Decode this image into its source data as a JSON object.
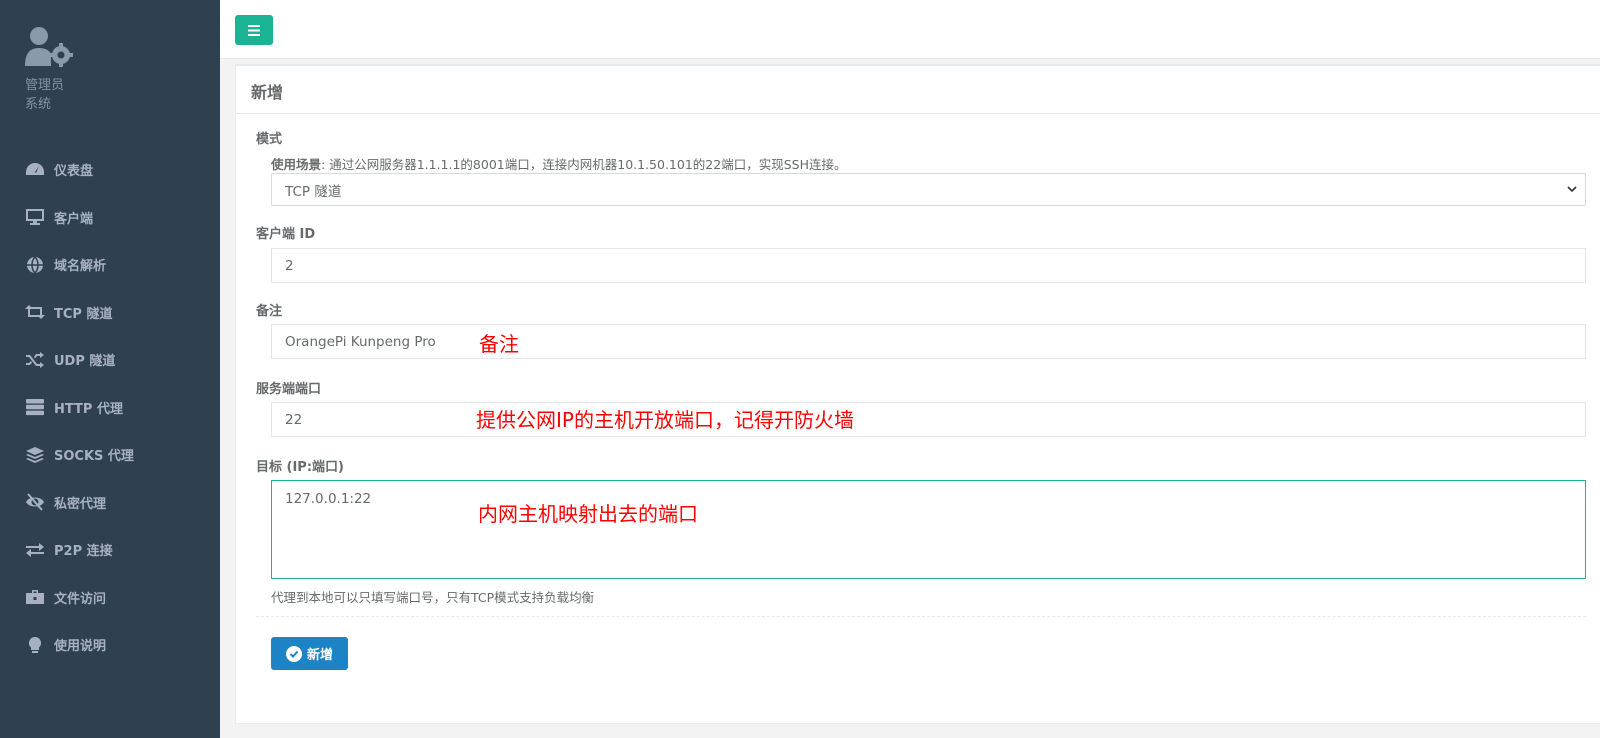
{
  "sidebar": {
    "profile": {
      "name": "管理员",
      "role": "系统"
    },
    "items": [
      {
        "label": "仪表盘",
        "icon": "dashboard-icon"
      },
      {
        "label": "客户端",
        "icon": "monitor-icon"
      },
      {
        "label": "域名解析",
        "icon": "globe-icon"
      },
      {
        "label": "TCP 隧道",
        "icon": "retweet-icon"
      },
      {
        "label": "UDP 隧道",
        "icon": "shuffle-icon"
      },
      {
        "label": "HTTP 代理",
        "icon": "server-icon"
      },
      {
        "label": "SOCKS 代理",
        "icon": "layers-icon"
      },
      {
        "label": "私密代理",
        "icon": "eye-slash-icon"
      },
      {
        "label": "P2P 连接",
        "icon": "exchange-icon"
      },
      {
        "label": "文件访问",
        "icon": "briefcase-icon"
      },
      {
        "label": "使用说明",
        "icon": "lightbulb-icon"
      }
    ]
  },
  "panel": {
    "title": "新增"
  },
  "form": {
    "mode": {
      "label": "模式",
      "help_prefix": "使用场景",
      "help_text": ": 通过公网服务器1.1.1.1的8001端口，连接内网机器10.1.50.101的22端口，实现SSH连接。",
      "selected": "TCP 隧道"
    },
    "client_id": {
      "label": "客户端 ID",
      "value": "2"
    },
    "remark": {
      "label": "备注",
      "value": "OrangePi Kunpeng Pro",
      "annotation": "备注"
    },
    "server_port": {
      "label": "服务端端口",
      "value": "22",
      "annotation": "提供公网IP的主机开放端口，记得开防火墙"
    },
    "target": {
      "label": "目标 (IP:端口)",
      "value": "127.0.0.1:22",
      "annotation": "内网主机映射出去的端口",
      "help": "代理到本地可以只填写端口号，只有TCP模式支持负载均衡"
    },
    "submit_label": "新增"
  },
  "colors": {
    "sidebar_bg": "#2f4050",
    "accent_green": "#1ab394",
    "primary_blue": "#1c84c6",
    "annotation_red": "#ff0000"
  }
}
